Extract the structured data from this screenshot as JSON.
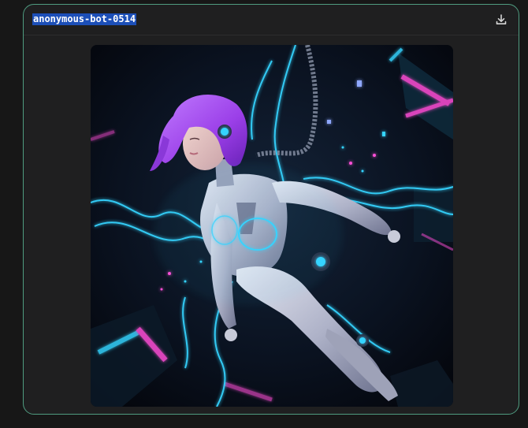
{
  "card": {
    "bot_name": "anonymous-bot-0514"
  },
  "icons": {
    "download": "download-icon"
  },
  "image": {
    "subject": "generated-image"
  },
  "colors": {
    "card_border": "#4f9c80",
    "name_highlight": "#1c4fb8",
    "neon_cyan": "#35d4ff",
    "neon_pink": "#ff4fd8",
    "hair_purple": "#a04df0"
  }
}
